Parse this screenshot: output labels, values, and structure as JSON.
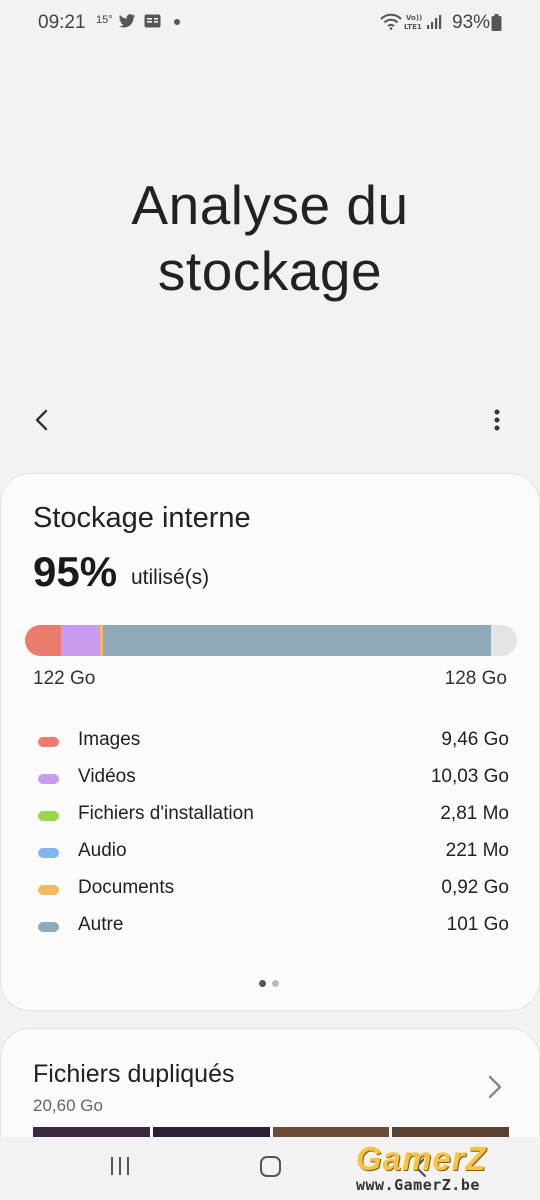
{
  "status_bar": {
    "time": "09:21",
    "temperature": "15°",
    "battery_percent": "93%",
    "icons": [
      "twitter-icon",
      "news-icon",
      "notification-dot",
      "wifi-icon",
      "volte-lte-icon",
      "signal-icon",
      "battery-icon"
    ]
  },
  "header": {
    "title": "Analyse du stockage"
  },
  "storage": {
    "title": "Stockage interne",
    "percent": "95%",
    "percent_label": "utilisé(s)",
    "bar_min": "122 Go",
    "bar_max": "128 Go",
    "bar_segments": [
      {
        "name": "Images",
        "fraction": 0.074,
        "color": "#ec7d6e"
      },
      {
        "name": "Vidéos",
        "fraction": 0.078,
        "color": "#c89af0"
      },
      {
        "name": "Documents",
        "fraction": 0.007,
        "color": "#f4b863"
      },
      {
        "name": "Autre",
        "fraction": 0.789,
        "color": "#8fa9bb"
      }
    ],
    "categories": [
      {
        "label": "Images",
        "value": "9,46 Go",
        "color": "#ec7d6e"
      },
      {
        "label": "Vidéos",
        "value": "10,03 Go",
        "color": "#c89af0"
      },
      {
        "label": "Fichiers d'installation",
        "value": "2,81 Mo",
        "color": "#9ad64a"
      },
      {
        "label": "Audio",
        "value": "221 Mo",
        "color": "#86b4f0"
      },
      {
        "label": "Documents",
        "value": "0,92 Go",
        "color": "#f4b863"
      },
      {
        "label": "Autre",
        "value": "101 Go",
        "color": "#8fa9bb"
      }
    ],
    "pager": {
      "pages": 2,
      "current": 1
    }
  },
  "duplicates": {
    "title": "Fichiers dupliqués",
    "size": "20,60 Go"
  },
  "watermark": {
    "logo": "GamerZ",
    "url": "www.GamerZ.be"
  }
}
